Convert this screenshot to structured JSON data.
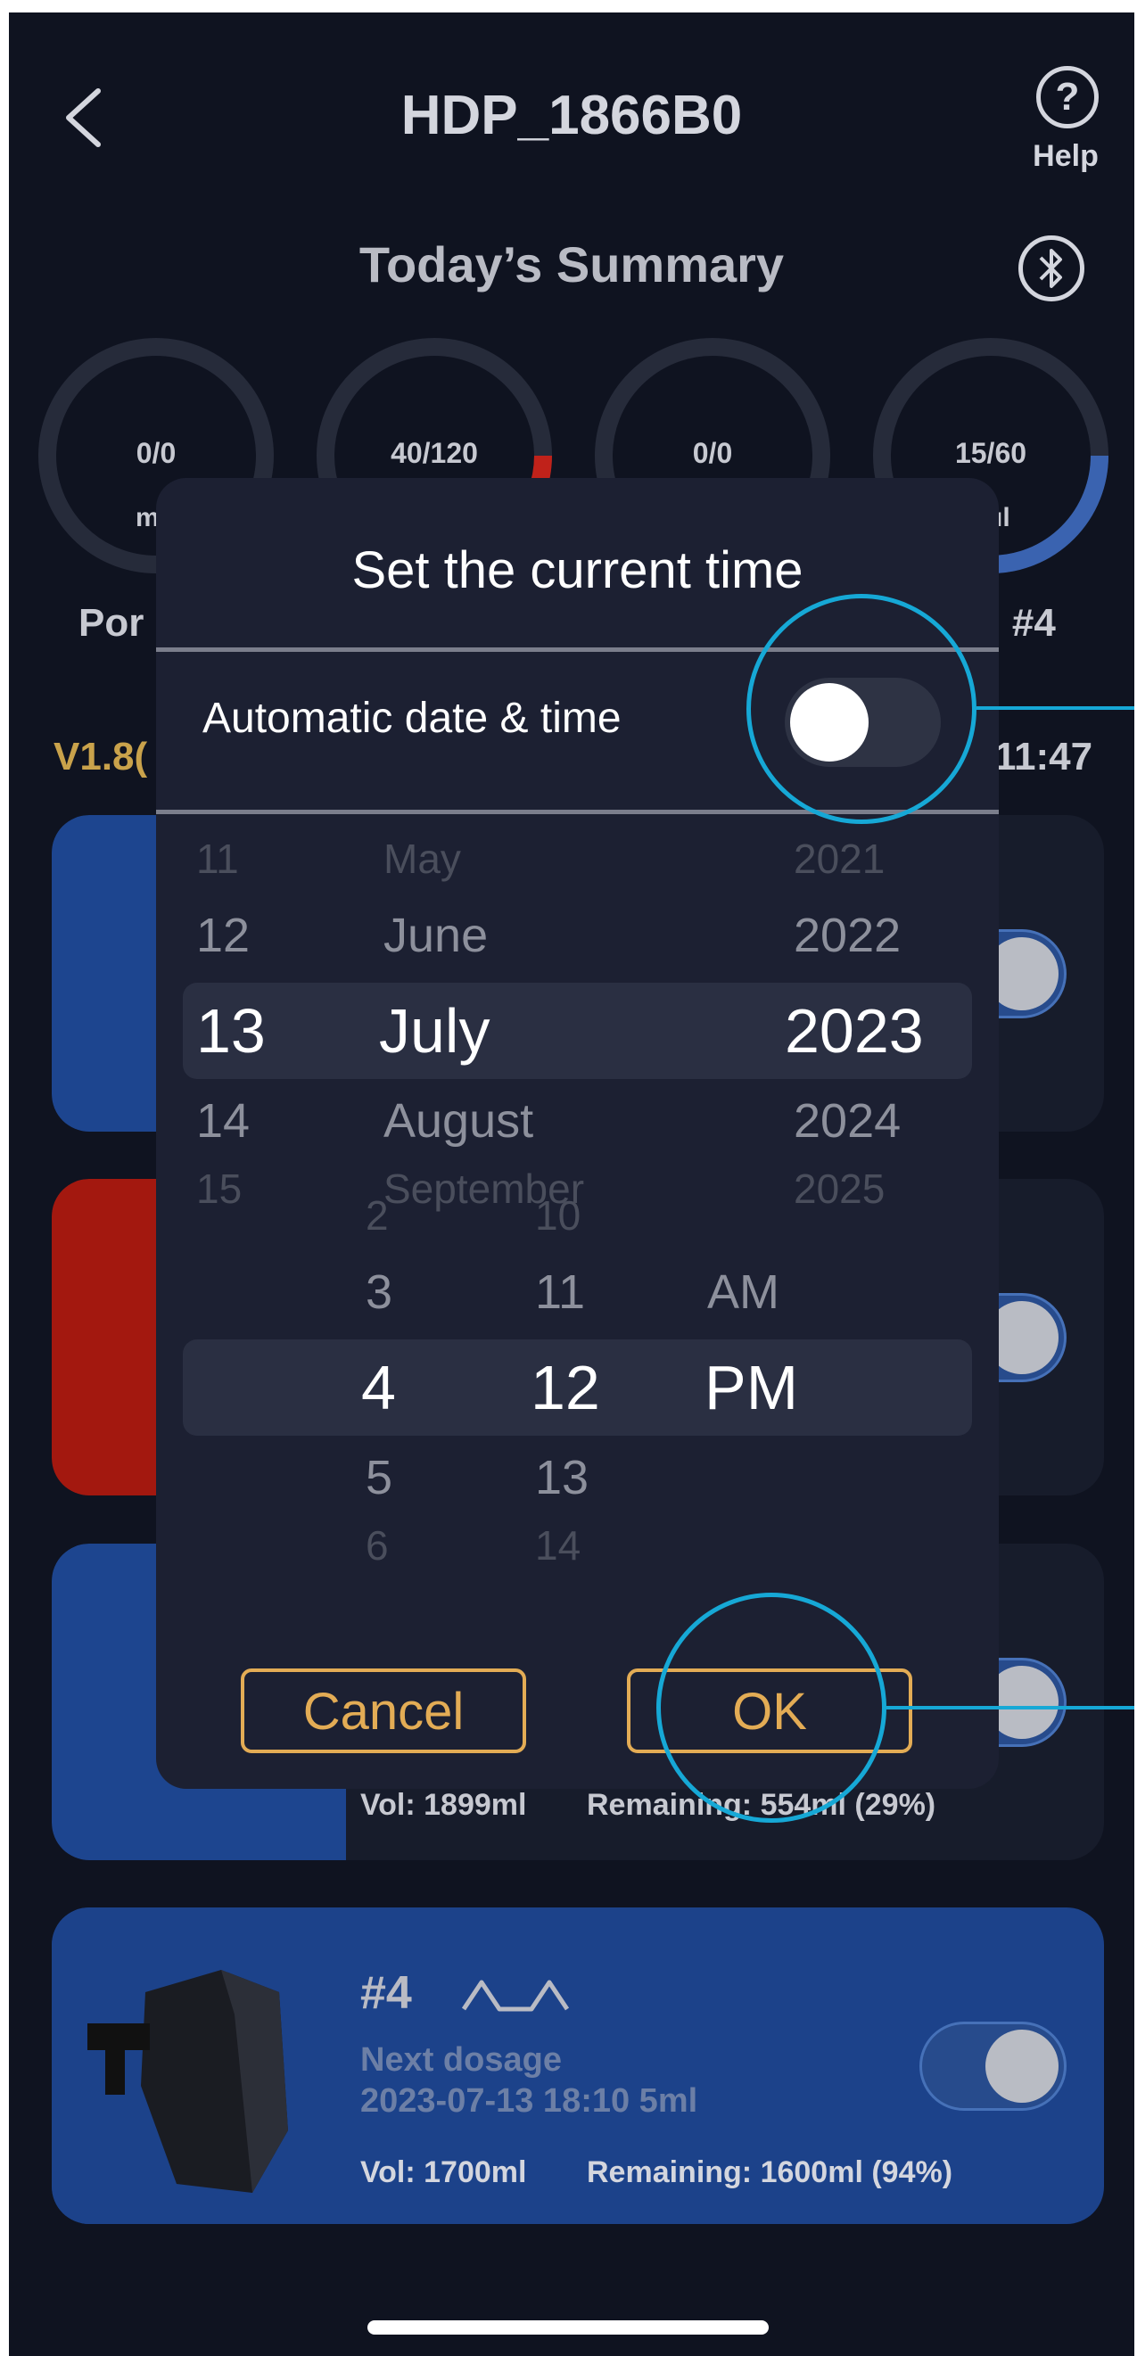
{
  "header": {
    "back_icon": "chevron-left-icon",
    "title": "HDP_1866B0",
    "help_label": "Help",
    "help_icon_glyph": "?"
  },
  "summary": {
    "title": "Today’s Summary",
    "bluetooth_icon": "bluetooth-icon",
    "rings": [
      {
        "value": "0/0",
        "sub": "m"
      },
      {
        "value": "40/120",
        "sub": ""
      },
      {
        "value": "0/0",
        "sub": ""
      },
      {
        "value": "15/60",
        "sub": "ıl"
      }
    ],
    "ring_progress": [
      0,
      0.333,
      0,
      0.25
    ],
    "peek_left": "Por",
    "peek_right": ": #4",
    "version_peek": "V1.8(",
    "time_peek": "11:47"
  },
  "cards": [
    {
      "index": "",
      "toggle_on": true
    },
    {
      "index": "",
      "toggle_on": true
    },
    {
      "index": "",
      "toggle_on": true,
      "vol": "Vol: 1899ml",
      "remaining": "Remaining: 554ml (29%)"
    },
    {
      "index": "#4",
      "wave_icon": "wave-icon",
      "next_label": "Next dosage",
      "next_value": "2023-07-13 18:10  5ml",
      "vol": "Vol: 1700ml",
      "remaining": "Remaining: 1600ml (94%)",
      "toggle_on": true
    }
  ],
  "modal": {
    "title": "Set the current time",
    "auto_label": "Automatic date & time",
    "auto_enabled": false,
    "date_picker": {
      "days": [
        "11",
        "12",
        "13",
        "14",
        "15"
      ],
      "months": [
        "May",
        "June",
        "July",
        "August",
        "September"
      ],
      "years": [
        "2021",
        "2022",
        "2023",
        "2024",
        "2025"
      ],
      "selected": {
        "day": "13",
        "month": "July",
        "year": "2023"
      }
    },
    "time_picker": {
      "hours": [
        "2",
        "3",
        "4",
        "5",
        "6"
      ],
      "minutes": [
        "10",
        "11",
        "12",
        "13",
        "14"
      ],
      "periods": [
        "AM",
        "PM"
      ],
      "selected": {
        "hour": "4",
        "minute": "12",
        "period": "PM"
      }
    },
    "cancel_label": "Cancel",
    "ok_label": "OK"
  },
  "colors": {
    "background": "#0f1320",
    "modal": "#1c2032",
    "accent_gold": "#e3ac55",
    "highlight_blue": "#16a8d6",
    "card_blue": "#1d458f",
    "card_red": "#a3180f"
  }
}
